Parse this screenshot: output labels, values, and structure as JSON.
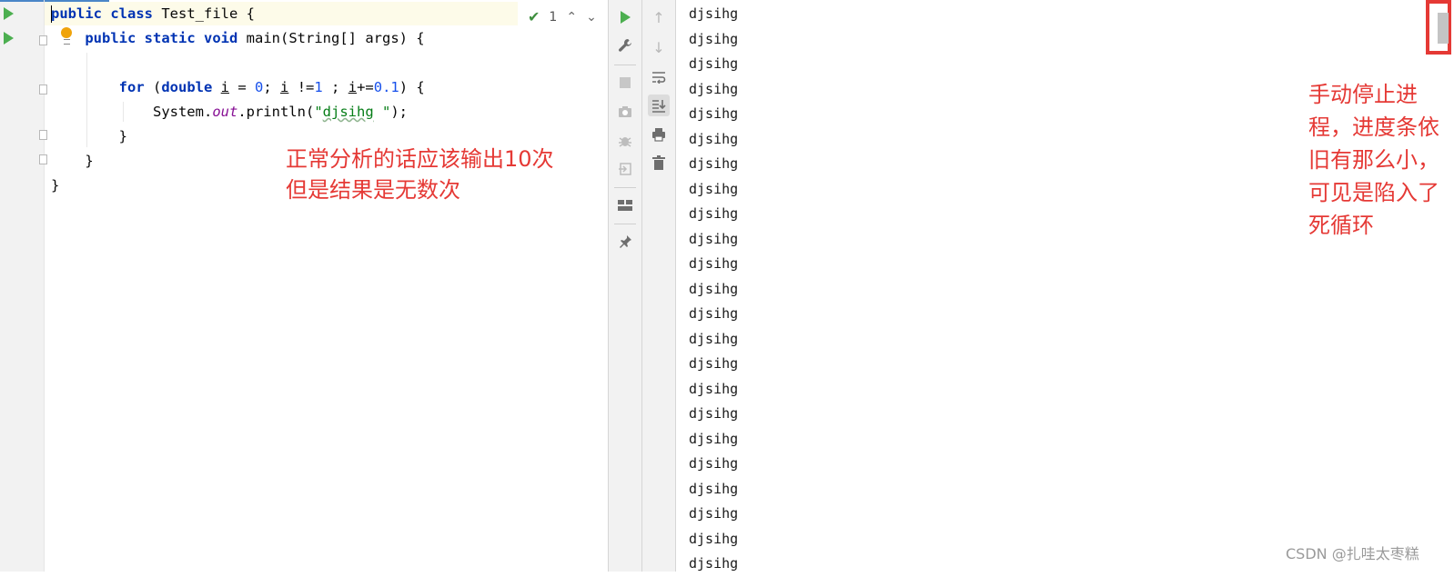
{
  "editor": {
    "lines": [
      [
        {
          "t": "public",
          "c": "kw"
        },
        {
          "t": " "
        },
        {
          "t": "class",
          "c": "kw"
        },
        {
          "t": " Test_file {"
        }
      ],
      [
        {
          "t": "    "
        },
        {
          "t": "public",
          "c": "kw"
        },
        {
          "t": " "
        },
        {
          "t": "static",
          "c": "kw"
        },
        {
          "t": " "
        },
        {
          "t": "void",
          "c": "kw"
        },
        {
          "t": " main(String[] args) {"
        }
      ],
      [
        {
          "t": ""
        }
      ],
      [
        {
          "t": "        "
        },
        {
          "t": "for",
          "c": "kw"
        },
        {
          "t": " ("
        },
        {
          "t": "double",
          "c": "kw"
        },
        {
          "t": " "
        },
        {
          "t": "i",
          "c": "var"
        },
        {
          "t": " = "
        },
        {
          "t": "0",
          "c": "num"
        },
        {
          "t": "; "
        },
        {
          "t": "i",
          "c": "var"
        },
        {
          "t": " !="
        },
        {
          "t": "1",
          "c": "num"
        },
        {
          "t": " ; "
        },
        {
          "t": "i",
          "c": "var"
        },
        {
          "t": "+="
        },
        {
          "t": "0.1",
          "c": "num"
        },
        {
          "t": ") {"
        }
      ],
      [
        {
          "t": "            System."
        },
        {
          "t": "out",
          "c": "fld"
        },
        {
          "t": ".println("
        },
        {
          "t": "\"",
          "c": "str"
        },
        {
          "t": "djsihg",
          "c": "str wavy"
        },
        {
          "t": " \"",
          "c": "str"
        },
        {
          "t": ");"
        }
      ],
      [
        {
          "t": "        }"
        }
      ],
      [
        {
          "t": "    }"
        }
      ],
      [
        {
          "t": "}"
        }
      ]
    ],
    "inspection": {
      "count": "1",
      "up": "⌃",
      "down": "⌄"
    },
    "annotation": [
      "正常分析的话应该输出10次",
      "但是结果是无数次"
    ]
  },
  "toolbar_left": {
    "rerun_icon": "play-icon",
    "settings_icon": "wrench-icon",
    "stop_icon": "stop-icon",
    "camera_icon": "camera-icon",
    "debug_icon": "bug-icon",
    "exit_icon": "exit-icon",
    "layout_icon": "layout-icon",
    "pin_icon": "pin-icon"
  },
  "toolbar_right": {
    "up_icon": "arrow-up-icon",
    "down_icon": "arrow-down-icon",
    "wrap_icon": "soft-wrap-icon",
    "scroll_end_icon": "scroll-to-end-icon",
    "print_icon": "print-icon",
    "clear_icon": "trash-icon"
  },
  "console": {
    "output": [
      "djsihg",
      "djsihg",
      "djsihg",
      "djsihg",
      "djsihg",
      "djsihg",
      "djsihg",
      "djsihg",
      "djsihg",
      "djsihg",
      "djsihg",
      "djsihg",
      "djsihg",
      "djsihg",
      "djsihg",
      "djsihg",
      "djsihg",
      "djsihg",
      "djsihg",
      "djsihg",
      "djsihg",
      "djsihg",
      "djsihg"
    ],
    "annotation": "手动停止进程，进度条依旧有那么小，可见是陷入了死循环",
    "watermark": "CSDN @扎哇太枣糕"
  },
  "colors": {
    "annotation": "#e53935",
    "keyword": "#0033b3",
    "string": "#067d17",
    "number": "#1750eb",
    "run": "#4caf50"
  }
}
